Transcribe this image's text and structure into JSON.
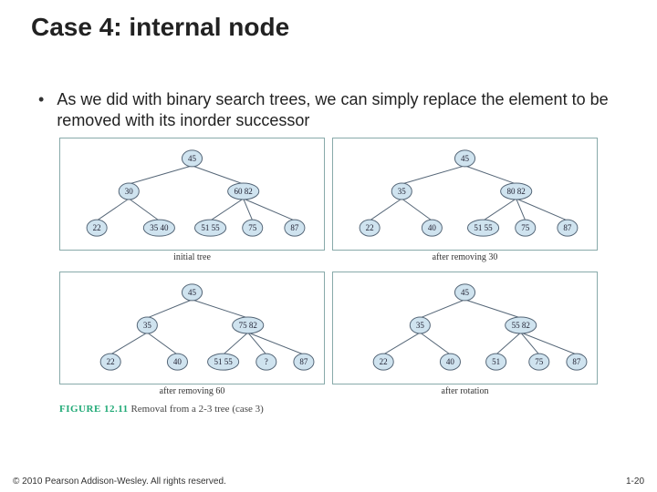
{
  "title": "Case 4: internal node",
  "bullet": "As we did with binary search trees, we can simply replace the element to be removed with its inorder successor",
  "figure_number": "FIGURE 12.11",
  "figure_caption": "Removal from a 2-3 tree (case 3)",
  "copyright": "© 2010 Pearson Addison-Wesley. All rights reserved.",
  "page_number": "1-20",
  "trees": [
    {
      "caption": "initial tree",
      "root": [
        "45"
      ],
      "level1": [
        [
          "30"
        ],
        [
          "60",
          "82"
        ]
      ],
      "level2": [
        [
          "22"
        ],
        [
          "35",
          "40"
        ],
        [
          "51",
          "55"
        ],
        [
          "75"
        ],
        [
          "87"
        ]
      ]
    },
    {
      "caption": "after removing 30",
      "root": [
        "45"
      ],
      "level1": [
        [
          "35"
        ],
        [
          "80",
          "82"
        ]
      ],
      "level2": [
        [
          "22"
        ],
        [
          "40"
        ],
        [
          "51",
          "55"
        ],
        [
          "75"
        ],
        [
          "87"
        ]
      ]
    },
    {
      "caption": "after removing 60",
      "root": [
        "45"
      ],
      "level1": [
        [
          "35"
        ],
        [
          "75",
          "82"
        ]
      ],
      "level2": [
        [
          "22"
        ],
        [
          "40"
        ],
        [
          "51",
          "55"
        ],
        [
          "?"
        ],
        [
          "87"
        ]
      ]
    },
    {
      "caption": "after rotation",
      "root": [
        "45"
      ],
      "level1": [
        [
          "35"
        ],
        [
          "55",
          "82"
        ]
      ],
      "level2": [
        [
          "22"
        ],
        [
          "40"
        ],
        [
          "51"
        ],
        [
          "75"
        ],
        [
          "87"
        ]
      ]
    }
  ]
}
